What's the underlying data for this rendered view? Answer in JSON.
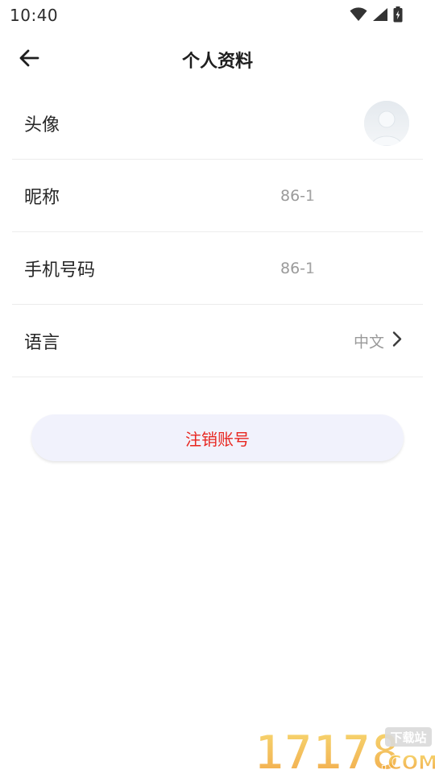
{
  "status_bar": {
    "time": "10:40",
    "icons": [
      "wifi-icon",
      "cellular-signal-icon",
      "battery-charging-icon"
    ]
  },
  "header": {
    "title": "个人资料",
    "back_icon": "arrow-left-icon"
  },
  "profile_rows": [
    {
      "label": "头像",
      "value": null,
      "type": "avatar"
    },
    {
      "label": "昵称",
      "value": "86-1",
      "type": "masked-text"
    },
    {
      "label": "手机号码",
      "value": "86-1",
      "type": "masked-text"
    },
    {
      "label": "语言",
      "value": "中文",
      "type": "text-with-chevron"
    }
  ],
  "actions": {
    "deactivate_label": "注销账号"
  },
  "watermark": {
    "number_text": "17178",
    "badge_text": "下载站",
    "suffix_text": ".COM"
  },
  "colors": {
    "danger_text": "#e8261f",
    "button_bg": "#f1f2fc",
    "secondary_text": "#9a9a9a",
    "divider": "#ececec"
  }
}
